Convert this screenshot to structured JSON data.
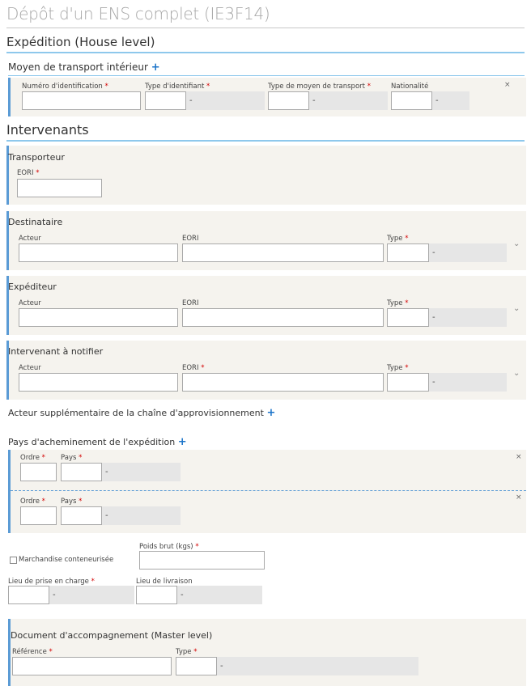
{
  "page_title": "Dépôt d'un ENS complet (IE3F14)",
  "expedition": {
    "title": "Expédition (House level)",
    "transport": {
      "title": "Moyen de transport intérieur",
      "plus": "+",
      "labels": {
        "id_number": "Numéro d'identification",
        "id_type": "Type d'identifiant",
        "means_type": "Type de moyen de transport",
        "nationality": "Nationalité"
      },
      "dash": "-",
      "required": "*",
      "remove": "×"
    }
  },
  "intervenants": {
    "title": "Intervenants",
    "transporteur": {
      "title": "Transporteur",
      "eori_label": "EORI"
    },
    "destinataire": {
      "title": "Destinataire",
      "acteur": "Acteur",
      "eori": "EORI",
      "type": "Type"
    },
    "expediteur": {
      "title": "Expéditeur",
      "acteur": "Acteur",
      "eori": "EORI",
      "type": "Type"
    },
    "notifier": {
      "title": "Intervenant à notifier",
      "acteur": "Acteur",
      "eori": "EORI",
      "type": "Type"
    }
  },
  "supply_chain": {
    "title": "Acteur supplémentaire de la chaîne d'approvisionnement",
    "plus": "+"
  },
  "routing": {
    "title": "Pays d'acheminement de l'expédition",
    "plus": "+",
    "ordre": "Ordre",
    "pays": "Pays"
  },
  "container": {
    "label": "Marchandise conteneurisée",
    "checked": false
  },
  "gross_weight": {
    "label": "Poids brut (kgs)"
  },
  "pickup": {
    "label": "Lieu de prise en charge"
  },
  "delivery": {
    "label": "Lieu de livraison"
  },
  "document": {
    "title": "Document d'accompagnement (Master level)",
    "reference": "Référence",
    "type": "Type"
  },
  "chevron": "⌄",
  "colors": {
    "accent": "#5b9bd5",
    "required": "#d40000",
    "panel": "#f5f3ee",
    "plus": "#1a73c9"
  }
}
